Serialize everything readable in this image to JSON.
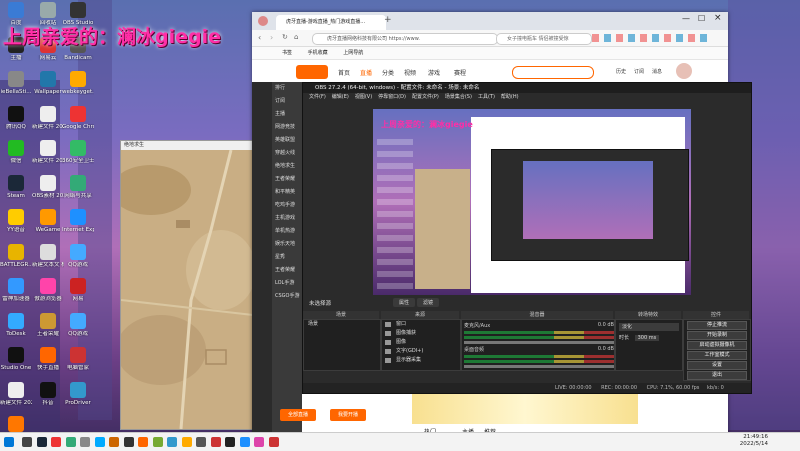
{
  "overlay": {
    "text": "上周亲爱的：澜冰giegie"
  },
  "desktop": {
    "icons": [
      {
        "label": "百度",
        "color": "#3a7bd5"
      },
      {
        "label": "回收站",
        "color": "#9aa"
      },
      {
        "label": "OBS Studio",
        "color": "#333"
      },
      {
        "label": "主播",
        "color": "#222"
      },
      {
        "label": "网易云",
        "color": "#d33"
      },
      {
        "label": "Bandicam",
        "color": "#555"
      },
      {
        "label": "ieBellaSti...",
        "color": "#888"
      },
      {
        "label": "Wallpaper",
        "color": "#27a"
      },
      {
        "label": "webkeyget...",
        "color": "#fa0"
      },
      {
        "label": "腾讯QQ",
        "color": "#111"
      },
      {
        "label": "新建文件 20211213...",
        "color": "#eee"
      },
      {
        "label": "Google Chrome",
        "color": "#e33"
      },
      {
        "label": "微信",
        "color": "#2b2"
      },
      {
        "label": "新建文件 2021121...",
        "color": "#eee"
      },
      {
        "label": "360安全卫士",
        "color": "#3b6"
      },
      {
        "label": "Steam",
        "color": "#1b2838"
      },
      {
        "label": "OBS素材 2021121...",
        "color": "#eee"
      },
      {
        "label": "网络与共享",
        "color": "#3a7"
      },
      {
        "label": "YY语音",
        "color": "#fc0"
      },
      {
        "label": "WeGame",
        "color": "#f90"
      },
      {
        "label": "Internet Explorer",
        "color": "#1e90ff"
      },
      {
        "label": "BATTLEGR...",
        "color": "#e8b400"
      },
      {
        "label": "新建文本文 档.txt",
        "color": "#ddd"
      },
      {
        "label": "QQ游戏",
        "color": "#4af"
      },
      {
        "label": "雷神加速器",
        "color": "#39f"
      },
      {
        "label": "傲游浏览器",
        "color": "#f4a"
      },
      {
        "label": "网易",
        "color": "#c22"
      },
      {
        "label": "ToDesk",
        "color": "#3af"
      },
      {
        "label": "王者荣耀",
        "color": "#c93"
      },
      {
        "label": "QQ游戏",
        "color": "#4af"
      },
      {
        "label": "Studio One",
        "color": "#111"
      },
      {
        "label": "快手直播",
        "color": "#f60"
      },
      {
        "label": "电脑管家",
        "color": "#c33"
      },
      {
        "label": "新建文件 2021...",
        "color": "#eee"
      },
      {
        "label": "抖音",
        "color": "#111"
      },
      {
        "label": "ProDriver",
        "color": "#39c"
      },
      {
        "label": "斗鱼直播伴侣",
        "color": "#f70"
      }
    ]
  },
  "map_window": {
    "title": "绝地求生"
  },
  "browser": {
    "tab_title": "虎牙直播-游戏直播_热门游戏直播...",
    "new_tab": "+",
    "url": "虎牙直播网络科技有限公司  https://www.",
    "search_placeholder": "女子撞电瓶车 情侣被撞受惊",
    "bookmarks": [
      "书签",
      "手机收藏",
      "上网导航"
    ],
    "nav": [
      "首页",
      "直播",
      "分类",
      "视频",
      "游戏",
      "赛程"
    ],
    "nav_right": [
      "历史",
      "订阅",
      "消息"
    ],
    "side_items": [
      "排行",
      "订阅",
      "主播",
      "网游竞技",
      "英雄联盟",
      "穿越火线",
      "绝地求生",
      "王者荣耀",
      "和平精英",
      "吃鸡手游",
      "主机游戏",
      "单机热游",
      "娱乐天地",
      "星秀",
      "王者荣耀",
      "LOL手游",
      "CSGO手游"
    ],
    "footer_buttons": [
      "全部直播",
      "我要开播"
    ],
    "bottom_text": [
      "热门",
      "主播",
      "推荐"
    ]
  },
  "obs": {
    "title": "OBS 27.2.4 (64-bit, windows) - 配置文件: 未命名 - 场景: 未命名",
    "menu": [
      "文件(F)",
      "编辑(E)",
      "视图(V)",
      "停靠窗口(D)",
      "配置文件(P)",
      "场景集合(S)",
      "工具(T)",
      "帮助(H)"
    ],
    "status_no_source": "未选择源",
    "prop_btn": "属性",
    "filter_btn": "滤镜",
    "panels": {
      "scenes": "场景",
      "sources": "来源",
      "mixer": "混音器",
      "transitions": "转场特效",
      "controls": "控件"
    },
    "scene_items": [
      "场景"
    ],
    "sources": [
      "窗口",
      "图像捕获",
      "图像",
      "文字(GDI+)",
      "显示器采集"
    ],
    "mixer": [
      {
        "name": "麦克风/Aux",
        "db": "0.0 dB"
      },
      {
        "name": "桌面音频",
        "db": "0.0 dB"
      }
    ],
    "transition": {
      "name": "淡化",
      "duration_label": "时长",
      "duration": "300 ms"
    },
    "controls": [
      "停止推流",
      "开始录制",
      "启动虚拟摄像机",
      "工作室模式",
      "设置",
      "退出"
    ],
    "status": {
      "live": "LIVE: 00:00:00",
      "rec": "REC: 00:00:00",
      "cpu": "CPU: 7.1%, 60.00 fps",
      "kbps": "kb/s: 0"
    }
  },
  "taskbar": {
    "time": "21:49:16",
    "date": "2022/5/14"
  }
}
